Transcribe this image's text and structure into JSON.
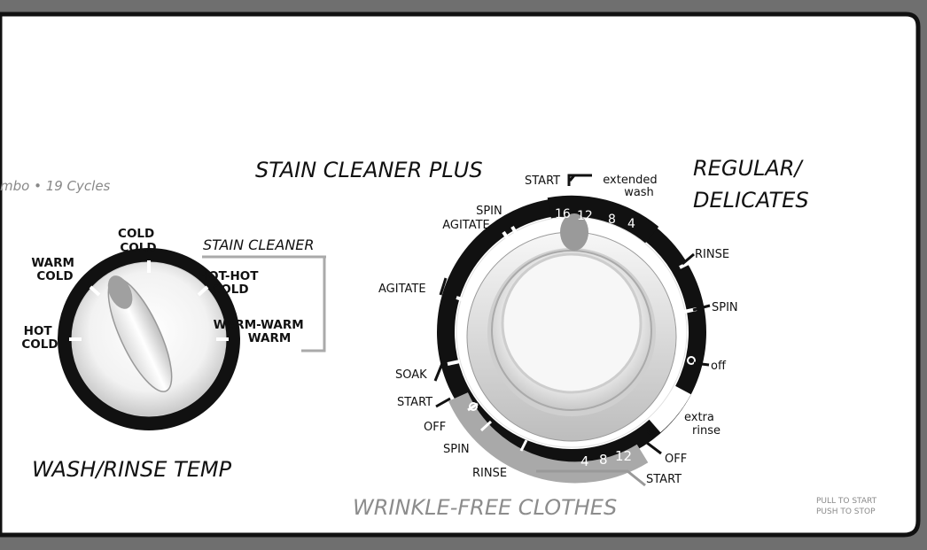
{
  "header": {
    "cycles_text": "mbo • 19 Cycles"
  },
  "temp_dial": {
    "title": "WASH/RINSE TEMP",
    "group_label": "STAIN CLEANER",
    "settings": {
      "hot_cold": [
        "HOT",
        "COLD"
      ],
      "warm_cold": [
        "WARM",
        "COLD"
      ],
      "cold_cold": [
        "COLD",
        "COLD"
      ],
      "hot_hot_cold": [
        "HOT-HOT",
        "COLD"
      ],
      "warm_warm_warm": [
        "WARM-WARM",
        "WARM"
      ]
    }
  },
  "cycle_dial": {
    "stain_title": "STAIN CLEANER PLUS",
    "regular_title": [
      "REGULAR/",
      "DELICATES"
    ],
    "wrinkle_title": "WRINKLE-FREE CLOTHES",
    "top_start": "START",
    "extended_wash": [
      "extended",
      "wash"
    ],
    "extended_minutes": [
      "16",
      "12",
      "8",
      "4"
    ],
    "wrinkle_minutes": [
      "4",
      "8",
      "12"
    ],
    "stain_steps": {
      "spin_agitate": [
        "SPIN",
        "AGITATE"
      ],
      "agitate": "AGITATE",
      "soak": "SOAK",
      "start": "START"
    },
    "wrinkle_steps": {
      "off": "OFF",
      "spin": "SPIN",
      "rinse": "RINSE"
    },
    "regular_steps": {
      "rinse": "RINSE",
      "spin": "SPIN",
      "off": "off",
      "extra_rinse": [
        "extra",
        "rinse"
      ],
      "off_upper": "OFF",
      "start": "START"
    },
    "pull_push": [
      "PULL TO START",
      "PUSH TO STOP"
    ]
  },
  "colors": {
    "panel": "#ffffff",
    "frame": "#6f6f6f",
    "ink": "#111111",
    "muted_label": "#8a8a8a"
  }
}
